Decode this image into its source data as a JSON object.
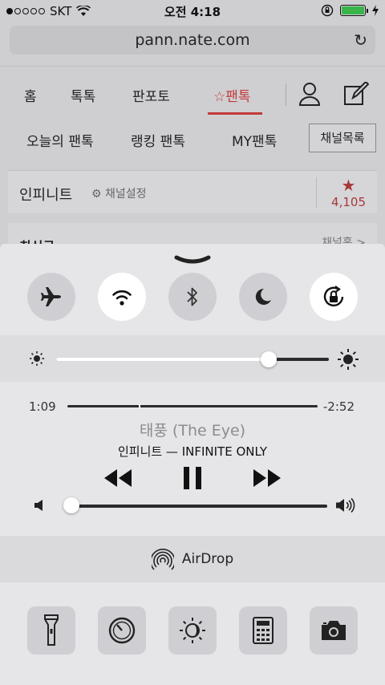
{
  "status_bar": {
    "carrier": "SKT",
    "time": "오전 4:18",
    "battery_level": 1.0
  },
  "browser": {
    "url": "pann.nate.com"
  },
  "site_nav": {
    "items": [
      "홈",
      "톡톡",
      "판포토",
      "☆팬톡"
    ],
    "active_index": 3
  },
  "site_subnav": {
    "items": [
      "오늘의 팬톡",
      "랭킹 팬톡",
      "MY팬톡"
    ],
    "channel_list_button": "채널목록"
  },
  "channel_card": {
    "name": "인피니트",
    "settings_label": "채널설정",
    "star_count": "4,105"
  },
  "list_header": {
    "title": "최신글",
    "link": "채널홈 >"
  },
  "control_center": {
    "toggles": [
      {
        "name": "airplane",
        "on": false
      },
      {
        "name": "wifi",
        "on": true
      },
      {
        "name": "bluetooth",
        "on": false
      },
      {
        "name": "do-not-disturb",
        "on": false
      },
      {
        "name": "rotation-lock",
        "on": true
      }
    ],
    "brightness_level": 0.78,
    "music": {
      "elapsed": "1:09",
      "remaining": "-2:52",
      "progress": 0.29,
      "title": "태풍 (The Eye)",
      "artist_album": "인피니트 — INFINITE ONLY"
    },
    "volume_level": 0.02,
    "airdrop_label": "AirDrop",
    "shortcuts": [
      "flashlight",
      "timer",
      "night-shift",
      "calculator",
      "camera"
    ]
  }
}
